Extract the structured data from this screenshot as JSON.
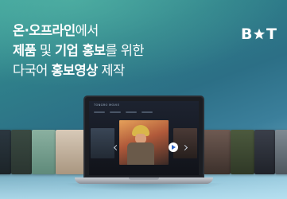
{
  "headline": {
    "line1": {
      "bold": "온·오프라인",
      "regular": "에서"
    },
    "line2": {
      "bold1": "제품",
      "regular1": " 및 ",
      "bold2": "기업 홍보",
      "regular2": "를 위한"
    },
    "line3": {
      "regular1": "다국어 ",
      "bold": "홍보영상",
      "regular2": " 제작"
    }
  },
  "logo": {
    "letter1": "B",
    "letter2": "T",
    "mark_icon": "star-icon"
  },
  "laptop_screen": {
    "title": "TONGRO MOVIE",
    "play_icon": "play-icon"
  },
  "colors": {
    "headline_text": "#ffffff",
    "background_top": "#3f9f9a",
    "background_bottom": "#7fb7cf",
    "play_button": "#2f63c4"
  }
}
